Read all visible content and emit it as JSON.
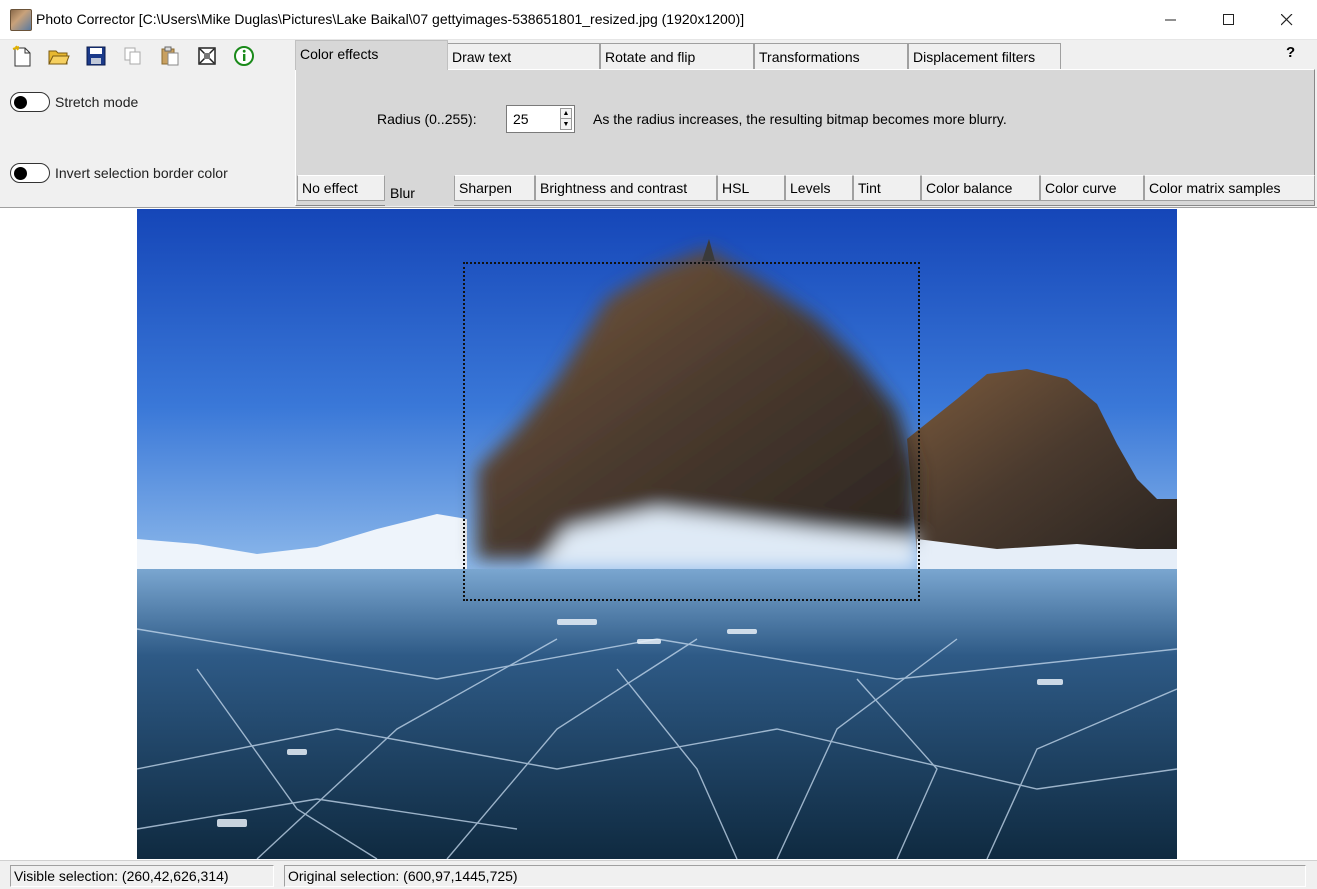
{
  "window": {
    "title": "Photo Corrector [C:\\Users\\Mike Duglas\\Pictures\\Lake Baikal\\07 gettyimages-538651801_resized.jpg (1920x1200)]"
  },
  "toolbar": {
    "icons": [
      "new-icon",
      "open-folder-icon",
      "save-icon",
      "copy-icon",
      "paste-icon",
      "fit-icon",
      "info-icon"
    ]
  },
  "options": {
    "stretch_mode": "Stretch mode",
    "invert_border": "Invert selection border color"
  },
  "tabs": {
    "top": [
      "Color effects",
      "Draw text",
      "Rotate and flip",
      "Transformations",
      "Displacement filters"
    ],
    "active_top": "Color effects",
    "help": "?",
    "bottom": [
      "No effect",
      "Blur",
      "Sharpen",
      "Brightness and contrast",
      "HSL",
      "Levels",
      "Tint",
      "Color balance",
      "Color curve",
      "Color matrix samples"
    ],
    "active_bottom": "Blur"
  },
  "blur": {
    "radius_label": "Radius (0..255):",
    "radius_value": "25",
    "description": "As the radius increases, the resulting bitmap becomes more blurry."
  },
  "status": {
    "visible_selection": "Visible selection: (260,42,626,314)",
    "original_selection": "Original selection: (600,97,1445,725)"
  }
}
